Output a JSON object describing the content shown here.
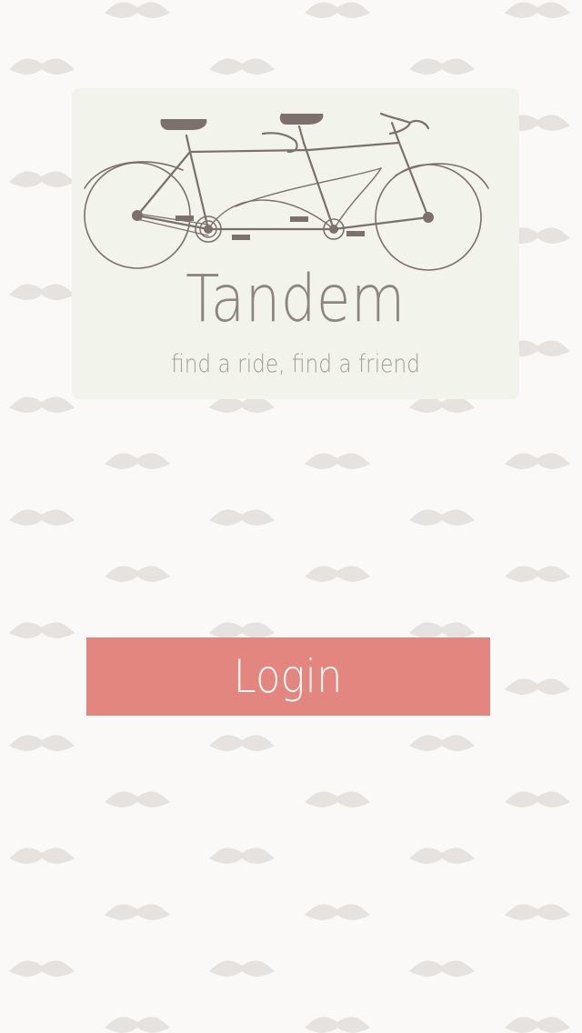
{
  "app": {
    "title": "Tandem",
    "tagline": "find a ride, find a friend"
  },
  "login_button": {
    "label": "Login"
  },
  "colors": {
    "background": "#fbf9f7",
    "card": "#f2f3ea",
    "bike_stroke": "#7b706a",
    "title_text": "#8c8581",
    "button": "#e38680",
    "button_text": "#fdf7f6",
    "pattern": "#e6e2df"
  },
  "icons": {
    "logo": "tandem-bicycle-icon",
    "pattern": "mustache-icon"
  }
}
